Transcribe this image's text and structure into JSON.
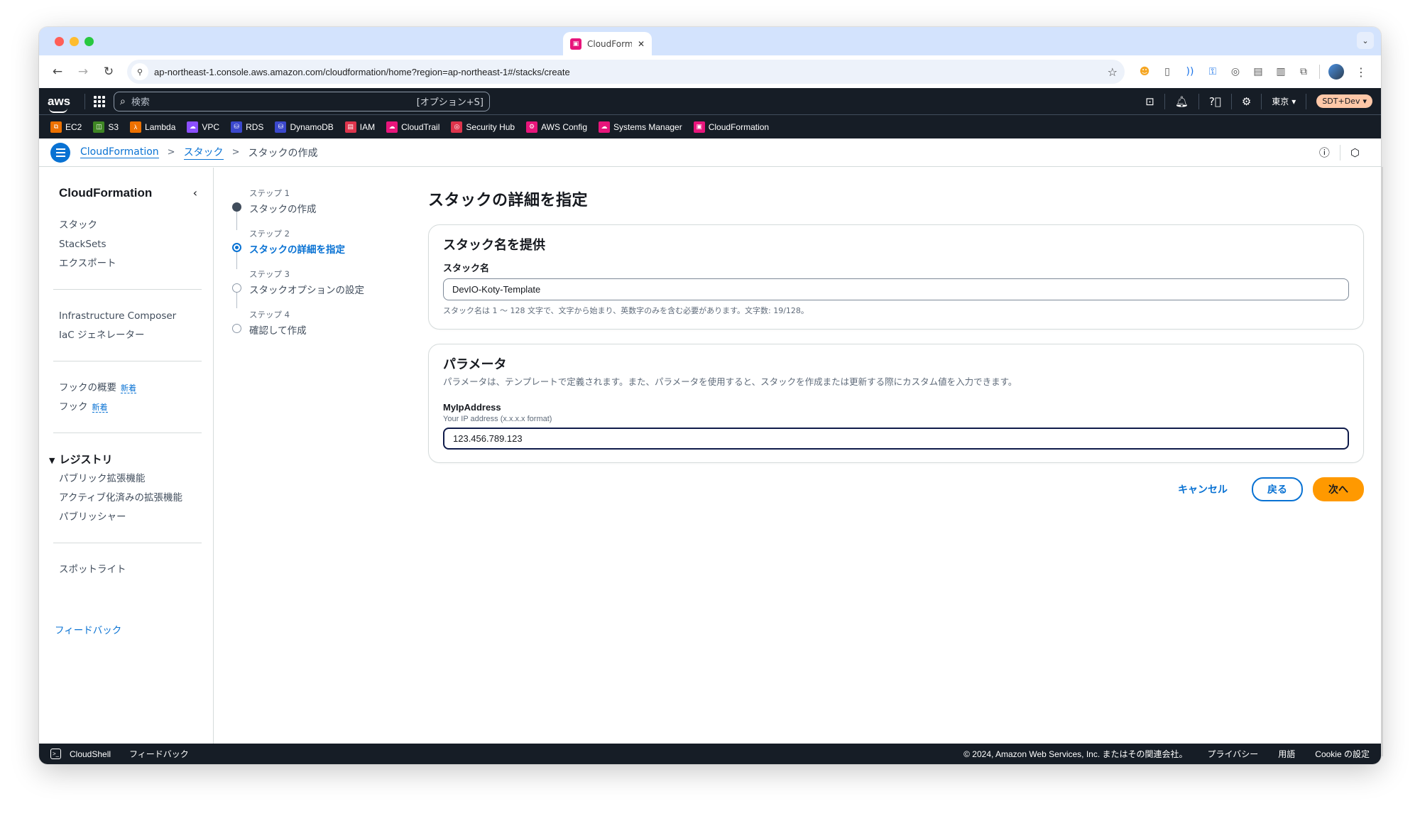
{
  "browser": {
    "tab_title": "CloudForm",
    "url": "ap-northeast-1.console.aws.amazon.com/cloudformation/home?region=ap-northeast-1#/stacks/create"
  },
  "aws_nav": {
    "logo": "aws",
    "search_placeholder": "検索",
    "search_shortcut": "[オプション+S]",
    "region": "東京",
    "account": "SDT+Dev"
  },
  "favorites": [
    {
      "label": "EC2",
      "icon": "ec2-icon",
      "color": "#ed7100"
    },
    {
      "label": "S3",
      "icon": "s3-icon",
      "color": "#3f8624"
    },
    {
      "label": "Lambda",
      "icon": "lambda-icon",
      "color": "#ed7100"
    },
    {
      "label": "VPC",
      "icon": "vpc-icon",
      "color": "#8c4fff"
    },
    {
      "label": "RDS",
      "icon": "rds-icon",
      "color": "#3b48cc"
    },
    {
      "label": "DynamoDB",
      "icon": "dynamodb-icon",
      "color": "#3b48cc"
    },
    {
      "label": "IAM",
      "icon": "iam-icon",
      "color": "#dd344c"
    },
    {
      "label": "CloudTrail",
      "icon": "cloudtrail-icon",
      "color": "#e7157b"
    },
    {
      "label": "Security Hub",
      "icon": "security-hub-icon",
      "color": "#dd344c"
    },
    {
      "label": "AWS Config",
      "icon": "aws-config-icon",
      "color": "#e7157b"
    },
    {
      "label": "Systems Manager",
      "icon": "systems-manager-icon",
      "color": "#e7157b"
    },
    {
      "label": "CloudFormation",
      "icon": "cloudformation-icon",
      "color": "#e7157b"
    }
  ],
  "breadcrumb": {
    "items": [
      "CloudFormation",
      "スタック"
    ],
    "current": "スタックの作成"
  },
  "sidenav": {
    "title": "CloudFormation",
    "group1": [
      "スタック",
      "StackSets",
      "エクスポート"
    ],
    "group2": [
      "Infrastructure Composer",
      "IaC ジェネレーター"
    ],
    "group3": [
      {
        "label": "フックの概要",
        "badge": "新着"
      },
      {
        "label": "フック",
        "badge": "新着"
      }
    ],
    "registry": {
      "title": "レジストリ",
      "items": [
        "パブリック拡張機能",
        "アクティブ化済みの拡張機能",
        "パブリッシャー"
      ]
    },
    "spotlight": "スポットライト",
    "feedback": "フィードバック"
  },
  "wizard": {
    "steps": [
      {
        "label": "ステップ 1",
        "title": "スタックの作成",
        "state": "done"
      },
      {
        "label": "ステップ 2",
        "title": "スタックの詳細を指定",
        "state": "current"
      },
      {
        "label": "ステップ 3",
        "title": "スタックオプションの設定",
        "state": "pending"
      },
      {
        "label": "ステップ 4",
        "title": "確認して作成",
        "state": "pending"
      }
    ]
  },
  "main": {
    "title": "スタックの詳細を指定",
    "stack_name_section": {
      "header": "スタック名を提供",
      "label": "スタック名",
      "value": "DevIO-Koty-Template",
      "constraint": "スタック名は 1 ～ 128 文字で、文字から始まり、英数字のみを含む必要があります。文字数: 19/128。"
    },
    "parameters_section": {
      "header": "パラメータ",
      "description": "パラメータは、テンプレートで定義されます。また、パラメータを使用すると、スタックを作成または更新する際にカスタム値を入力できます。",
      "params": [
        {
          "name": "MyIpAddress",
          "description": "Your IP address (x.x.x.x format)",
          "value": "123.456.789.123"
        }
      ]
    },
    "actions": {
      "cancel": "キャンセル",
      "back": "戻る",
      "next": "次へ"
    }
  },
  "footer": {
    "cloudshell": "CloudShell",
    "feedback": "フィードバック",
    "copyright": "© 2024, Amazon Web Services, Inc. またはその関連会社。",
    "privacy": "プライバシー",
    "terms": "用語",
    "cookie": "Cookie の設定"
  }
}
